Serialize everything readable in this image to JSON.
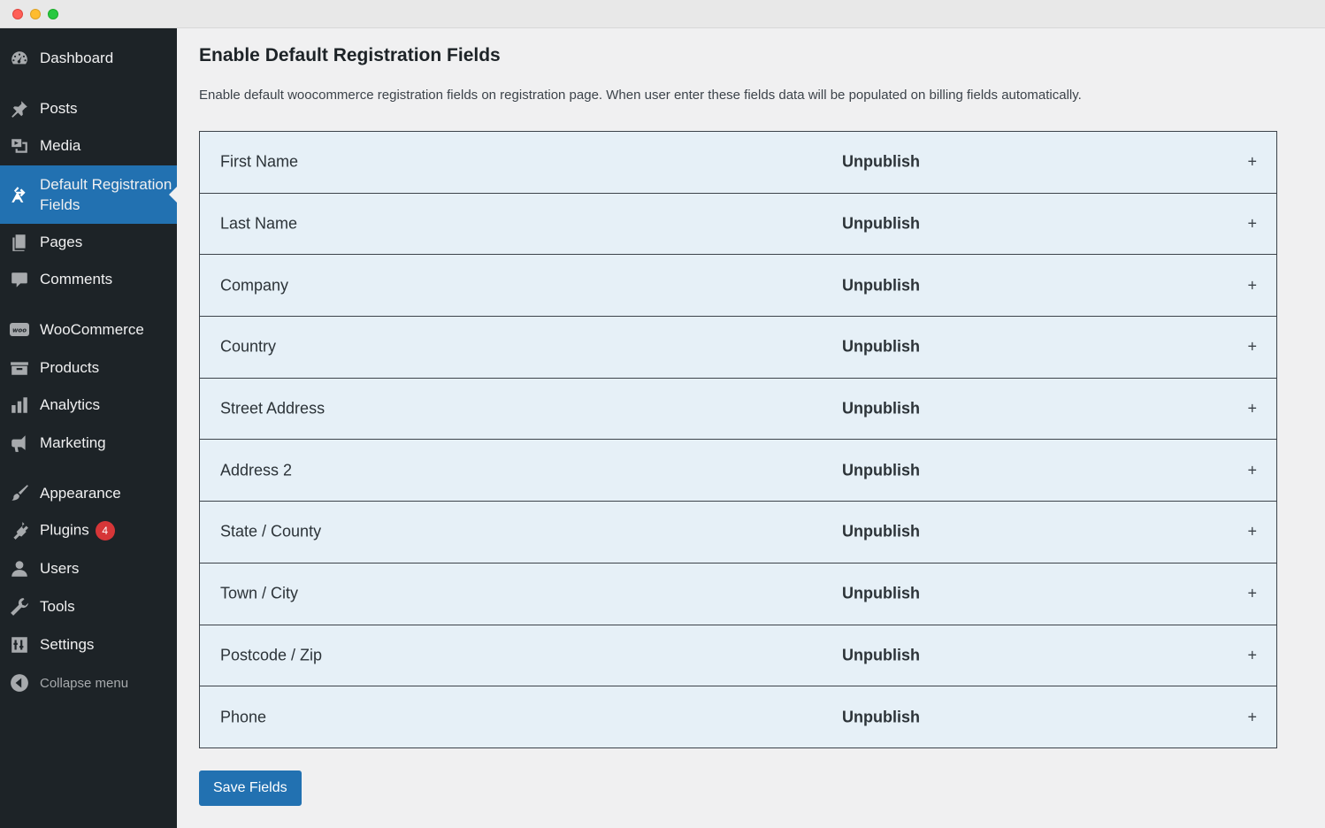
{
  "sidebar": {
    "items": [
      {
        "label": "Dashboard",
        "icon": "dashboard-icon"
      },
      {
        "label": "Posts",
        "icon": "pin-icon"
      },
      {
        "label": "Media",
        "icon": "media-icon"
      },
      {
        "label": "Default Registration Fields",
        "icon": "registration-fields-icon",
        "active": true
      },
      {
        "label": "Pages",
        "icon": "pages-icon"
      },
      {
        "label": "Comments",
        "icon": "comment-icon"
      },
      {
        "label": "WooCommerce",
        "icon": "woo-icon"
      },
      {
        "label": "Products",
        "icon": "archive-icon"
      },
      {
        "label": "Analytics",
        "icon": "bar-chart-icon"
      },
      {
        "label": "Marketing",
        "icon": "megaphone-icon"
      },
      {
        "label": "Appearance",
        "icon": "brush-icon"
      },
      {
        "label": "Plugins",
        "icon": "plug-icon",
        "badge": "4"
      },
      {
        "label": "Users",
        "icon": "user-icon"
      },
      {
        "label": "Tools",
        "icon": "wrench-icon"
      },
      {
        "label": "Settings",
        "icon": "sliders-icon"
      },
      {
        "label": "Collapse menu",
        "icon": "collapse-arrow-icon"
      }
    ]
  },
  "main": {
    "title": "Enable Default Registration Fields",
    "description": "Enable default woocommerce registration fields on registration page. When user enter these fields data will be populated on billing fields automatically.",
    "fields": [
      {
        "name": "First Name",
        "status": "Unpublish",
        "toggle": "+"
      },
      {
        "name": "Last Name",
        "status": "Unpublish",
        "toggle": "+"
      },
      {
        "name": "Company",
        "status": "Unpublish",
        "toggle": "+"
      },
      {
        "name": "Country",
        "status": "Unpublish",
        "toggle": "+"
      },
      {
        "name": "Street Address",
        "status": "Unpublish",
        "toggle": "+"
      },
      {
        "name": "Address 2",
        "status": "Unpublish",
        "toggle": "+"
      },
      {
        "name": "State / County",
        "status": "Unpublish",
        "toggle": "+"
      },
      {
        "name": "Town / City",
        "status": "Unpublish",
        "toggle": "+"
      },
      {
        "name": "Postcode / Zip",
        "status": "Unpublish",
        "toggle": "+"
      },
      {
        "name": "Phone",
        "status": "Unpublish",
        "toggle": "+"
      }
    ],
    "save_label": "Save Fields"
  },
  "colors": {
    "sidebar_bg": "#1d2327",
    "accent": "#2271b1",
    "row_bg": "#e6f0f7",
    "badge": "#d63638"
  }
}
